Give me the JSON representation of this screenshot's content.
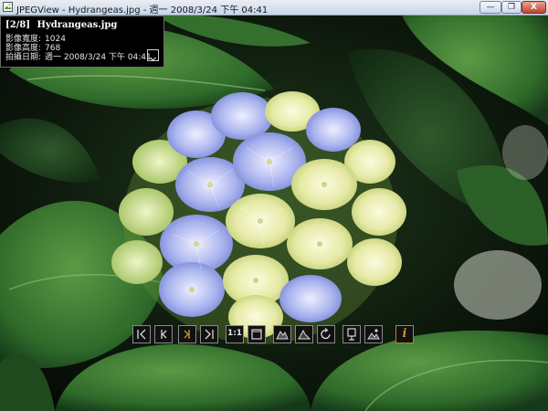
{
  "window": {
    "title": "JPEGView - Hydrangeas.jpg - 週一 2008/3/24 下午 04:41",
    "min_label": "—",
    "max_label": "❐",
    "close_label": "X"
  },
  "info_panel": {
    "index": "[2/8]",
    "filename": "Hydrangeas.jpg",
    "rows": [
      {
        "label": "影像寬度:",
        "value": "1024"
      },
      {
        "label": "影像高度:",
        "value": "768"
      },
      {
        "label": "拍攝日期:",
        "value": "週一 2008/3/24 下午 04:41"
      }
    ]
  },
  "toolbar": {
    "buttons": [
      {
        "icon": "first-image-icon"
      },
      {
        "icon": "previous-image-icon"
      },
      {
        "icon": "next-image-icon"
      },
      {
        "icon": "last-image-icon"
      },
      {
        "icon": "actual-size-icon",
        "label": "1:1"
      },
      {
        "icon": "fit-to-window-icon"
      },
      {
        "icon": "levels-icon"
      },
      {
        "icon": "contrast-icon"
      },
      {
        "icon": "rotate-icon"
      },
      {
        "icon": "keep-params-icon"
      },
      {
        "icon": "landscape-enhance-icon"
      },
      {
        "icon": "info-icon",
        "label": "i"
      }
    ],
    "accent_color": "#c8962b"
  },
  "colors": {
    "leaf": "#2f6b2a",
    "background": "#0b0f0b",
    "flower_blue": "#9aa8e8",
    "flower_cream": "#eef0b8"
  }
}
